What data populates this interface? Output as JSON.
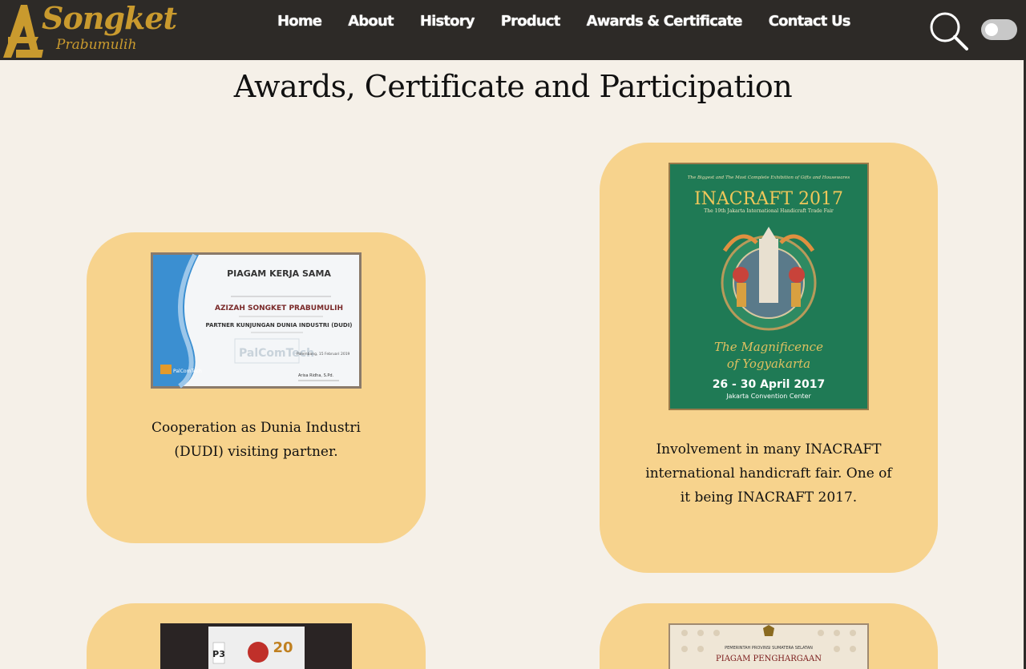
{
  "brand": {
    "title": "Songket",
    "subtitle": "Prabumulih",
    "mark": "A",
    "color": "#c99a2e"
  },
  "nav": {
    "items": [
      "Home",
      "About",
      "History",
      "Product",
      "Awards & Certificate",
      "Contact Us"
    ]
  },
  "header": {
    "search_icon": "search-icon",
    "theme_toggle_state": "off"
  },
  "page": {
    "title": "Awards, Certificate and Participation"
  },
  "cards": [
    {
      "image": {
        "heading": "PIAGAM KERJA SAMA",
        "line1": "AZIZAH SONGKET PRABUMULIH",
        "line2": "PARTNER KUNJUNGAN DUNIA INDUSTRI (DUDI)",
        "watermark": "PalComTech",
        "logo": "PalComTech",
        "date": "Palembang, 15 Februari 2019",
        "signer": "Arisa Ridha, S.Pd."
      },
      "text_lines": [
        "Cooperation as Dunia Industri",
        "(DUDI) visiting partner."
      ]
    },
    {
      "image": {
        "tagline": "The Biggest and The Most Complete Exhibition of Gifts and Housewares",
        "title": "INACRAFT 2017",
        "subtitle": "The 19th Jakarta International Handicraft Trade Fair",
        "theme1": "The Magnificence",
        "theme2": "of Yogyakarta",
        "dates": "26 - 30 April 2017",
        "venue": "Jakarta Convention Center"
      },
      "text_lines": [
        "Involvement in many INACRAFT",
        "international handicraft fair. One of",
        "it being INACRAFT 2017."
      ]
    },
    {
      "image": {
        "badge": "P3",
        "year": "20"
      },
      "text_lines": []
    },
    {
      "image": {
        "header": "PEMERINTAH PROVINSI SUMATERA SELATAN",
        "title": "PIAGAM PENGHARGAAN"
      },
      "text_lines": []
    }
  ],
  "colors": {
    "navbar": "#2d2a27",
    "background": "#f5f0e8",
    "card": "#f7d38d",
    "inacraft_green": "#1f7a55"
  }
}
